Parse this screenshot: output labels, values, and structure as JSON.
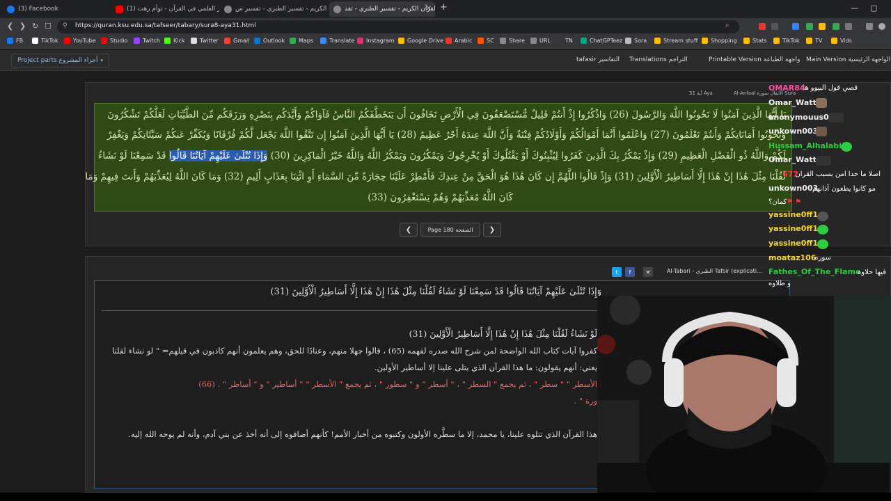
{
  "tabs": [
    {
      "label": "(3) Facebook",
      "color": "#1877f2"
    },
    {
      "label": "(1) الإعجاز العلمي في القرآن - توأم رهت...",
      "color": "#ff0000"
    },
    {
      "label": "القرآن الكريم - تفسير الطبري - تفسير س...",
      "color": "#888888"
    },
    {
      "label": "القرآن الكريم - تفسير الطبري - تفد...",
      "color": "#888888"
    }
  ],
  "address": {
    "url": "https://quran.ksu.edu.sa/tafseer/tabary/sura8-aya31.html"
  },
  "bookmarks": [
    {
      "label": "FB",
      "color": "#1877f2"
    },
    {
      "label": "TikTok",
      "color": "#ffffff"
    },
    {
      "label": "YouTube",
      "color": "#ff0000"
    },
    {
      "label": "Studio",
      "color": "#ff0000"
    },
    {
      "label": "Twitch",
      "color": "#9146ff"
    },
    {
      "label": "Kick",
      "color": "#53fc18"
    },
    {
      "label": "Twitter",
      "color": "#dddddd"
    },
    {
      "label": "Gmail",
      "color": "#ea4335"
    },
    {
      "label": "Outlook",
      "color": "#0078d4"
    },
    {
      "label": "Maps",
      "color": "#34a853"
    },
    {
      "label": "Translate",
      "color": "#4285f4"
    },
    {
      "label": "Instagram",
      "color": "#e1306c"
    },
    {
      "label": "Google Drive",
      "color": "#fbbc04"
    },
    {
      "label": "Arabic",
      "color": "#e53935"
    },
    {
      "label": "SC",
      "color": "#ff5500"
    },
    {
      "label": "Share",
      "color": "#888888"
    },
    {
      "label": "URL",
      "color": "#888888"
    },
    {
      "label": "TN",
      "color": "#888888"
    },
    {
      "label": "ChatGPTeez",
      "color": "#10a37f"
    },
    {
      "label": "Sora",
      "color": "#bbbbbb"
    },
    {
      "label": "Stream stuff",
      "color": "#fbbc04"
    },
    {
      "label": "Shopping",
      "color": "#fbbc04"
    },
    {
      "label": "Stats",
      "color": "#fbbc04"
    },
    {
      "label": "TikTok",
      "color": "#fbbc04"
    },
    {
      "label": "TV",
      "color": "#fbbc04"
    },
    {
      "label": "Vids",
      "color": "#fbbc04"
    }
  ],
  "site_nav": {
    "project_parts": "Project parts أجزاء المشروع",
    "tafsir": "tafasir التفاسير",
    "translations": "Translations التراجم",
    "printable": "Printable Version واجهة الطباعة",
    "main_version": "Main Version الواجهة الرئيسية"
  },
  "selectors": {
    "aya": "آية 31 Aya",
    "sura": "Al-Anfaal الأنفال سورة Sura"
  },
  "verse_lines": [
    {
      "before": "يَا أَيُّهَا الَّذِينَ آمَنُوا لَا تَخُونُوا اللَّهَ وَالرَّسُولَ (26) وَاذْكُرُوا إِذْ أَنتُمْ قَلِيلٌ مُّسْتَضْعَفُونَ فِي الْأَرْضِ تَخَافُونَ أَن يَتَخَطَّفَكُمُ النَّاسُ فَآوَاكُمْ وَأَيَّدَكُم بِنَصْرِهِ وَرَزَقَكُم مِّنَ الطَّيِّبَاتِ لَعَلَّكُمْ تَشْكُرُونَ",
      "sel": "",
      "after": ""
    },
    {
      "before": "وَتَخُونُوا أَمَانَاتِكُمْ وَأَنتُمْ تَعْلَمُونَ (27) وَاعْلَمُوا أَنَّمَا أَمْوَالُكُمْ وَأَوْلَادُكُمْ فِتْنَةٌ وَأَنَّ اللَّهَ عِندَهُ أَجْرٌ عَظِيمٌ (28) يَا أَيُّهَا الَّذِينَ آمَنُوا إِن تَتَّقُوا اللَّهَ يَجْعَل لَّكُمْ فُرْقَانًا وَيُكَفِّرْ عَنكُمْ سَيِّئَاتِكُمْ وَيَغْفِرْ",
      "sel": "",
      "after": ""
    },
    {
      "before": "لَكُمْ وَاللَّهُ ذُو الْفَضْلِ الْعَظِيمِ (29) وَإِذْ يَمْكُرُ بِكَ الَّذِينَ كَفَرُوا لِيُثْبِتُوكَ أَوْ يَقْتُلُوكَ أَوْ يُخْرِجُوكَ وَيَمْكُرُونَ وَيَمْكُرُ اللَّهُ وَاللَّهُ خَيْرُ الْمَاكِرِينَ (30)",
      "sel": "وَإِذَا تُتْلَىٰ عَلَيْهِمْ آيَاتُنَا قَالُوا",
      "after": "قَدْ سَمِعْنَا لَوْ نَشَاءُ"
    },
    {
      "before": "لَقُلْنَا مِثْلَ هَٰذَا إِنْ هَٰذَا إِلَّا أَسَاطِيرُ الْأَوَّلِينَ (31) وَإِذْ قَالُوا اللَّهُمَّ إِن كَانَ هَٰذَا هُوَ الْحَقَّ مِنْ عِندِكَ فَأَمْطِرْ عَلَيْنَا حِجَارَةً مِّنَ السَّمَاءِ أَوِ ائْتِنَا بِعَذَابٍ أَلِيمٍ (32) وَمَا كَانَ اللَّهُ لِيُعَذِّبَهُمْ وَأَنتَ فِيهِمْ وَمَا",
      "sel": "",
      "after": ""
    },
    {
      "before": "كَانَ اللَّهُ مُعَذِّبَهُمْ وَهُمْ يَسْتَغْفِرُونَ (33)",
      "sel": "",
      "after": ""
    }
  ],
  "pager": {
    "prev": "❮",
    "page": "Page 180 الصفحة",
    "next": "❯"
  },
  "tafsir_header": {
    "title": "Al-Tabari - الطبري Tafsir (explicati..."
  },
  "tafsir_lines": [
    "وَإِذَا تُتْلَىٰ عَلَيْهِمْ آيَاتُنَا قَالُوا قَدْ سَمِعْنَا لَوْ نَشَاءُ لَقُلْنَا مِثْلَ هَٰذَا إِنْ هَٰذَا إِلَّا أَسَاطِيرُ الْأَوَّلِينَ (31)",
    "لَوْ نَشَاءُ لَقُلْنَا مِثْلَ هَٰذَا إِنْ هَٰذَا إِلَّا أَسَاطِيرُ الْأَوَّلِينَ (31)",
    "كفروا آيات كتاب الله الواضحة لمن شرح الله صدره لفهمه (65) ، قالوا جهلا منهم، وعنادًا للحق، وهم يعلمون أنهم كاذبون في قيلهم= \" لو نشاء لقلنا",
    "يعني: أنهم يقولون: ما هذا القرآن الذي يتلى علينا إلا أساطير الأولين.",
    "الأسطر \" \" سطر \" ، ثم يجمع \" السطر \" ، \" أسطر \" و \" سطور \" ، ثم يجمع \" الأسطر \" \" أساطير \" و \" أساطر \" . (66)",
    "ورة \" .",
    "هذا القرآن الذي تتلوه علينا، يا محمد، إلا ما سطَّره الأولون وكتبوه من أخبار الأمم! كأنهم أضافوه إلى أنه أخذ عن بني آدم، وأنه لم يوحه الله إليه."
  ],
  "chat": [
    {
      "name": "OMAR84",
      "color": "#ff4da6",
      "msg": "قصي قول البيوو ها"
    },
    {
      "name": "Omar_Watt",
      "color": "#eeeeee",
      "msg": ""
    },
    {
      "name": "anonymouus0",
      "color": "#eeeeee",
      "msg": ""
    },
    {
      "name": "unkown003",
      "color": "#eeeeee",
      "msg": ""
    },
    {
      "name": "Hussam_Alhalabi",
      "color": "#2ecc40",
      "msg": ""
    },
    {
      "name": "Omar_Watt",
      "color": "#eeeeee",
      "msg": ""
    },
    {
      "name": "677",
      "color": "#ff3333",
      "msg": "اصلا ما حدا امن بسبب القران"
    },
    {
      "name": "unkown003",
      "color": "#eeeeee",
      "msg": "مو كانوا يطعون آذانهم"
    },
    {
      "name": "",
      "color": "#eeeeee",
      "msg": "كمان؟"
    },
    {
      "name": "yassine0ff1",
      "color": "#f5d742",
      "msg": ""
    },
    {
      "name": "yassine0ff1",
      "color": "#f5d742",
      "msg": ""
    },
    {
      "name": "yassine0ff1",
      "color": "#f5d742",
      "msg": ""
    },
    {
      "name": "moataz106",
      "color": "#f5d742",
      "msg": "سوره"
    },
    {
      "name": "Fathes_Of_The_Flame",
      "color": "#2ecc40",
      "msg": "فيها حلاوه"
    },
    {
      "name": "",
      "color": "#eeeeee",
      "msg": "و طلاوه"
    }
  ]
}
